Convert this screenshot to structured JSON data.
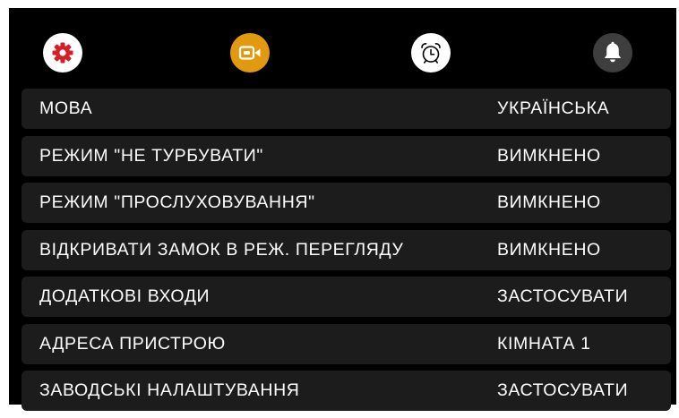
{
  "toolbar": {
    "icons": [
      {
        "name": "settings-icon",
        "color": "#d51f26",
        "active": true
      },
      {
        "name": "video-camera-icon",
        "color": "#e19a10"
      },
      {
        "name": "alarm-clock-icon",
        "color": "#ffffff"
      },
      {
        "name": "bell-icon",
        "color": "#3e3e3e"
      }
    ]
  },
  "menu": {
    "items": [
      {
        "label": "МОВА",
        "value": "УКРАЇНСЬКА"
      },
      {
        "label": "РЕЖИМ \"НЕ ТУРБУВАТИ\"",
        "value": "ВИМКНЕНО"
      },
      {
        "label": "РЕЖИМ \"ПРОСЛУХОВУВАННЯ\"",
        "value": "ВИМКНЕНО"
      },
      {
        "label": "ВІДКРИВАТИ ЗАМОК В РЕЖ. ПЕРЕГЛЯДУ",
        "value": "ВИМКНЕНО"
      },
      {
        "label": "ДОДАТКОВІ ВХОДИ",
        "value": "ЗАСТОСУВАТИ"
      },
      {
        "label": "АДРЕСА ПРИСТРОЮ",
        "value": "КІМНАТА 1"
      },
      {
        "label": "ЗАВОДСЬКІ НАЛАШТУВАННЯ",
        "value": "ЗАСТОСУВАТИ"
      }
    ]
  }
}
